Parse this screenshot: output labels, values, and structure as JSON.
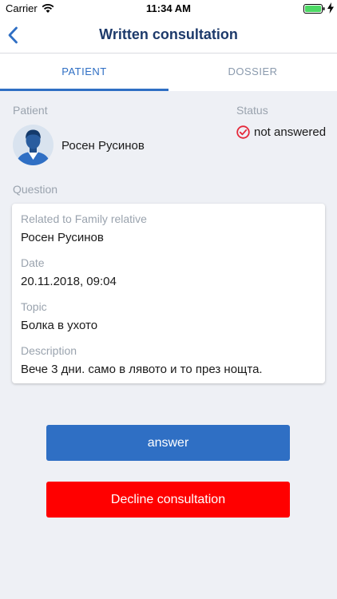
{
  "statusbar": {
    "carrier": "Carrier",
    "time": "11:34 AM"
  },
  "nav": {
    "title": "Written consultation"
  },
  "tabs": [
    {
      "label": "PATIENT",
      "active": true
    },
    {
      "label": "DOSSIER",
      "active": false
    }
  ],
  "patient": {
    "label": "Patient",
    "name": "Росен Русинов"
  },
  "status": {
    "label": "Status",
    "value": "not answered"
  },
  "question": {
    "label": "Question",
    "fields": [
      {
        "label": "Related to Family relative",
        "value": "Росен Русинов"
      },
      {
        "label": "Date",
        "value": "20.11.2018, 09:04"
      },
      {
        "label": "Topic",
        "value": "Болка в ухото"
      },
      {
        "label": "Description",
        "value": "Вече 3 дни. само в лявото и то през нощта."
      }
    ]
  },
  "actions": {
    "answer_label": "answer",
    "decline_label": "Decline consultation"
  },
  "colors": {
    "accent": "#2f6fc4",
    "nav_title": "#1d3a6b",
    "decline": "#ff0000",
    "status_icon": "#e5283a",
    "battery": "#4cd964",
    "background": "#eef0f5"
  },
  "icons": {
    "back": "chevron-left-icon",
    "status": "check-circle-icon",
    "avatar": "user-avatar"
  }
}
